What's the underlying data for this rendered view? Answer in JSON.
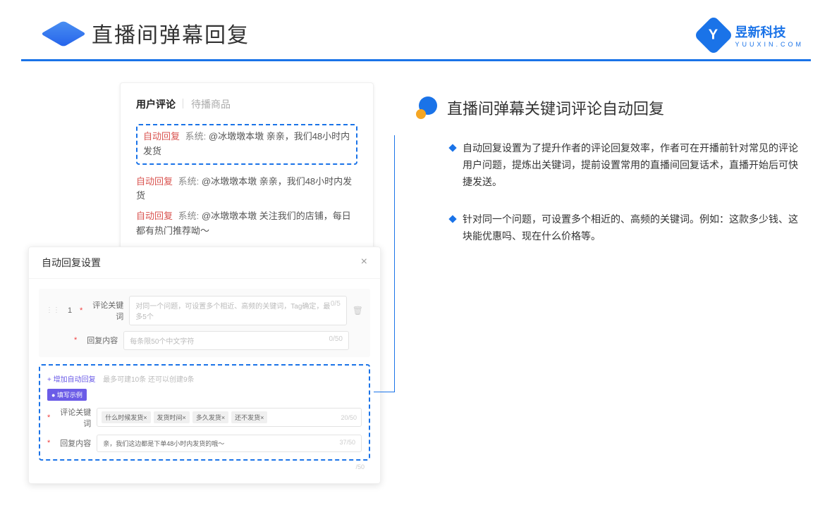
{
  "header": {
    "title": "直播间弹幕回复"
  },
  "brand": {
    "name": "昱新科技",
    "sub": "YUUXIN.COM",
    "letter": "Y"
  },
  "comments": {
    "tabs": {
      "active": "用户评论",
      "inactive": "待播商品"
    },
    "highlighted": {
      "tag": "自动回复",
      "sys": "系统:",
      "text": "@冰墩墩本墩 亲亲，我们48小时内发货"
    },
    "others": [
      {
        "tag": "自动回复",
        "sys": "系统:",
        "text": "@冰墩墩本墩 亲亲，我们48小时内发货"
      },
      {
        "tag": "自动回复",
        "sys": "系统:",
        "text": "@冰墩墩本墩 关注我们的店铺，每日都有热门推荐呦～"
      }
    ]
  },
  "settings": {
    "title": "自动回复设置",
    "close": "×",
    "num": "1",
    "label_keyword": "评论关键词",
    "placeholder_keyword": "对同一个问题，可设置多个相近、高频的关键词，Tag确定，最多5个",
    "count_keyword": "0/5",
    "label_content": "回复内容",
    "placeholder_content": "每条限50个中文字符",
    "count_content": "0/50",
    "add_link": "+ 增加自动回复",
    "add_hint": "最多可建10条 还可以创建9条",
    "example_badge": "● 填写示例",
    "ex_label_keyword": "评论关键词",
    "ex_tags": [
      "什么时候发货×",
      "发货时间×",
      "多久发货×",
      "还不发货×"
    ],
    "ex_tag_count": "20/50",
    "ex_label_content": "回复内容",
    "ex_content_value": "亲，我们这边都是下单48小时内发货的哦～",
    "ex_content_count": "37/50",
    "outer_count": "/50"
  },
  "right": {
    "section_title": "直播间弹幕关键词评论自动回复",
    "bullets": [
      "自动回复设置为了提升作者的评论回复效率，作者可在开播前针对常见的评论用户问题，提炼出关键词，提前设置常用的直播间回复话术，直播开始后可快捷发送。",
      "针对同一个问题，可设置多个相近的、高频的关键词。例如：这款多少钱、这块能优惠吗、现在什么价格等。"
    ]
  }
}
